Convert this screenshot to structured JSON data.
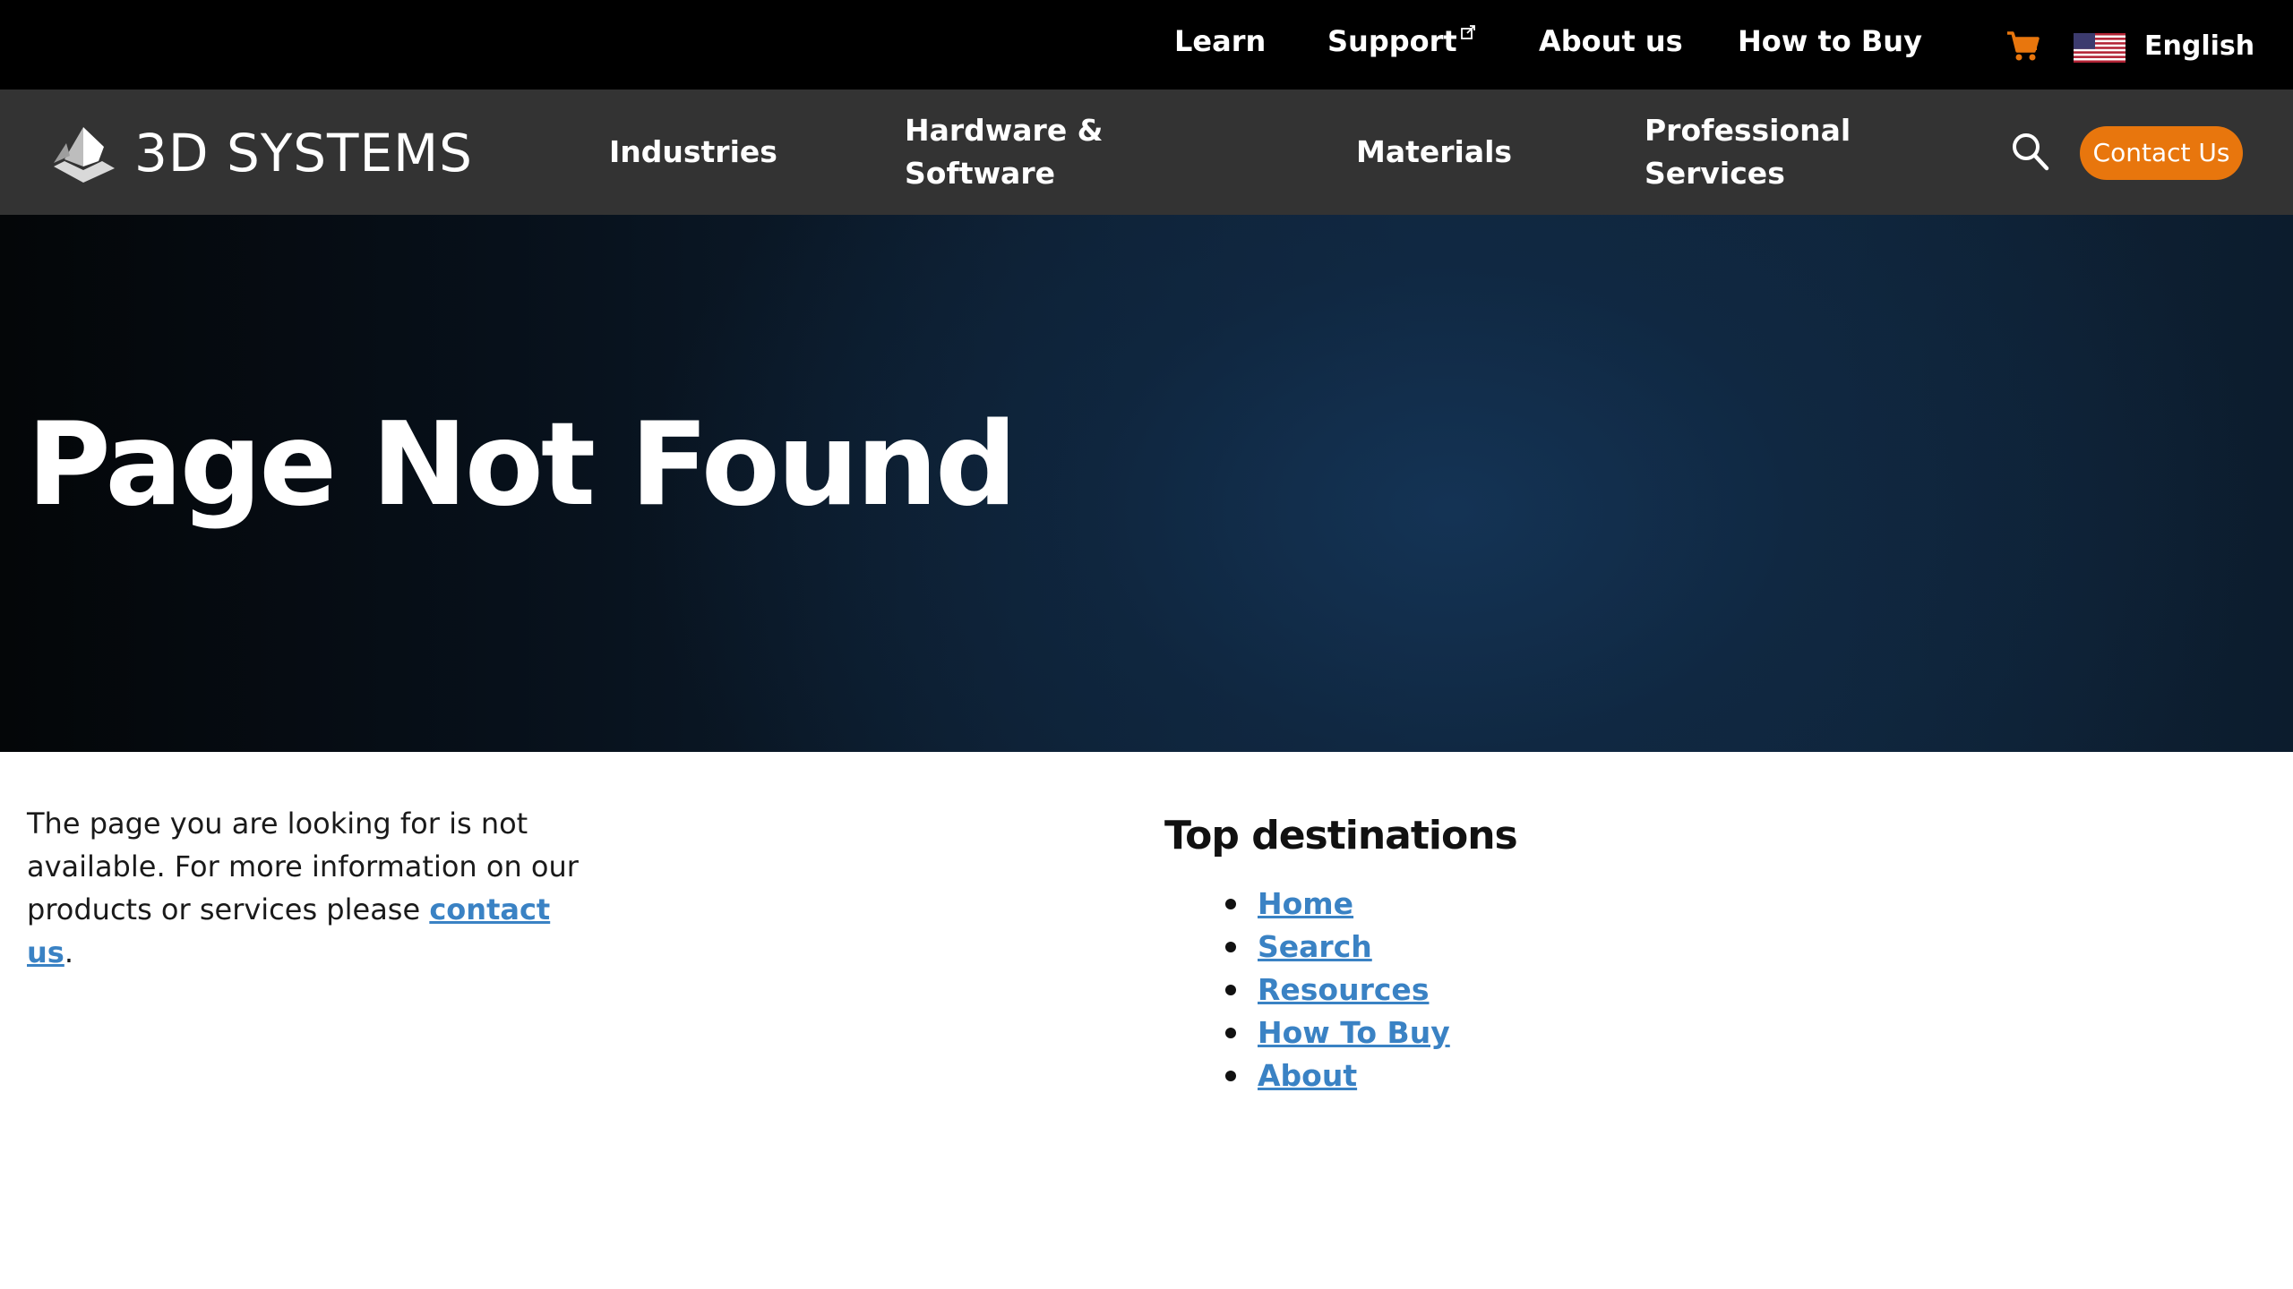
{
  "utility_nav": {
    "learn": "Learn",
    "support": "Support",
    "about": "About us",
    "how_to_buy": "How to Buy",
    "language": "English"
  },
  "brand": {
    "name": "3D SYSTEMS"
  },
  "main_nav": {
    "industries": "Industries",
    "hardware": "Hardware & Software",
    "materials": "Materials",
    "services": "Professional Services",
    "contact_button": "Contact Us"
  },
  "hero": {
    "title": "Page Not Found"
  },
  "content": {
    "message_before": "The page you are looking for is not available. For more information on our products or services please ",
    "message_link": "contact us",
    "message_after": "."
  },
  "top_destinations": {
    "heading": "Top destinations",
    "links": [
      {
        "label": "Home"
      },
      {
        "label": "Search"
      },
      {
        "label": "Resources"
      },
      {
        "label": "How To Buy"
      },
      {
        "label": "About"
      }
    ]
  },
  "icons": {
    "cart": "cart-icon",
    "flag": "us-flag-icon",
    "search": "search-icon",
    "external": "external-link-icon",
    "logo": "3d-systems-logo-icon"
  },
  "colors": {
    "accent": "#e8760d",
    "link": "#3a82c4",
    "nav_background": "#333333",
    "utility_background": "#000000"
  }
}
